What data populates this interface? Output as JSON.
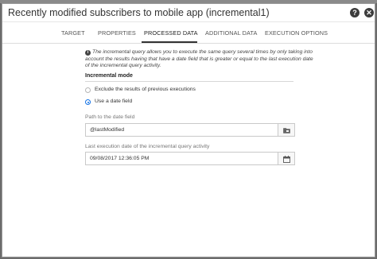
{
  "dialog": {
    "title": "Recently modified subscribers to mobile app (incremental1)",
    "help_glyph": "?",
    "close_glyph": "✕"
  },
  "tabs": [
    {
      "label": "TARGET"
    },
    {
      "label": "PROPERTIES"
    },
    {
      "label": "PROCESSED DATA",
      "active": true
    },
    {
      "label": "ADDITIONAL DATA"
    },
    {
      "label": "EXECUTION OPTIONS"
    }
  ],
  "info": {
    "icon_glyph": "i",
    "text": "The incremental query allows you to execute the same query several times by only taking into account the results having that have a date field that is greater or equal to the last execution date of the incremental query activity."
  },
  "incremental_mode": {
    "label": "Incremental mode",
    "options": [
      {
        "label": "Exclude the results of previous executions",
        "checked": false
      },
      {
        "label": "Use a date field",
        "checked": true
      }
    ]
  },
  "date_path": {
    "label": "Path to the date field",
    "value": "@lastModified",
    "button_icon": "folder-icon"
  },
  "last_execution": {
    "label": "Last execution date of the incremental query activity",
    "value": "09/08/2017 12:36:05 PM",
    "button_icon": "calendar-icon"
  },
  "colors": {
    "accent": "#1473e6",
    "backdrop": "#6b6b6b"
  }
}
